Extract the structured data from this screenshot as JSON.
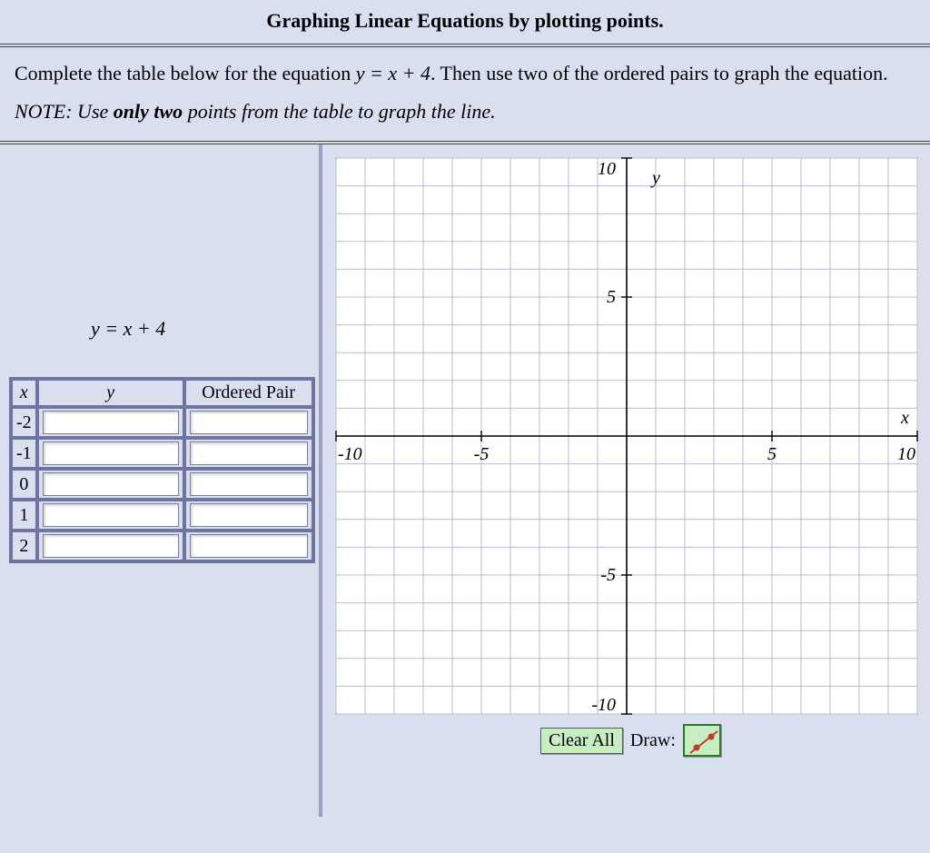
{
  "title": "Graphing Linear Equations by plotting points.",
  "instructions_pre": "Complete the table below for the equation ",
  "equation_inline": "y = x + 4",
  "instructions_post": ". Then use two of the ordered pairs to graph the equation.",
  "note_pre": "NOTE: Use ",
  "note_bold": "only two",
  "note_post": " points from the table to graph the line.",
  "equation_header": "y = x + 4",
  "table": {
    "headers": {
      "x": "x",
      "y": "y",
      "pair": "Ordered Pair"
    },
    "rows": [
      {
        "x": "-2",
        "y": "",
        "pair": ""
      },
      {
        "x": "-1",
        "y": "",
        "pair": ""
      },
      {
        "x": "0",
        "y": "",
        "pair": ""
      },
      {
        "x": "1",
        "y": "",
        "pair": ""
      },
      {
        "x": "2",
        "y": "",
        "pair": ""
      }
    ]
  },
  "chart_data": {
    "type": "scatter",
    "title": "",
    "xlabel": "x",
    "ylabel": "y",
    "xlim": [
      -10,
      10
    ],
    "ylim": [
      -10,
      10
    ],
    "xticks": [
      -10,
      -5,
      5,
      10
    ],
    "yticks": [
      -10,
      -5,
      5,
      10
    ],
    "series": []
  },
  "controls": {
    "clear": "Clear All",
    "draw_label": "Draw:"
  }
}
